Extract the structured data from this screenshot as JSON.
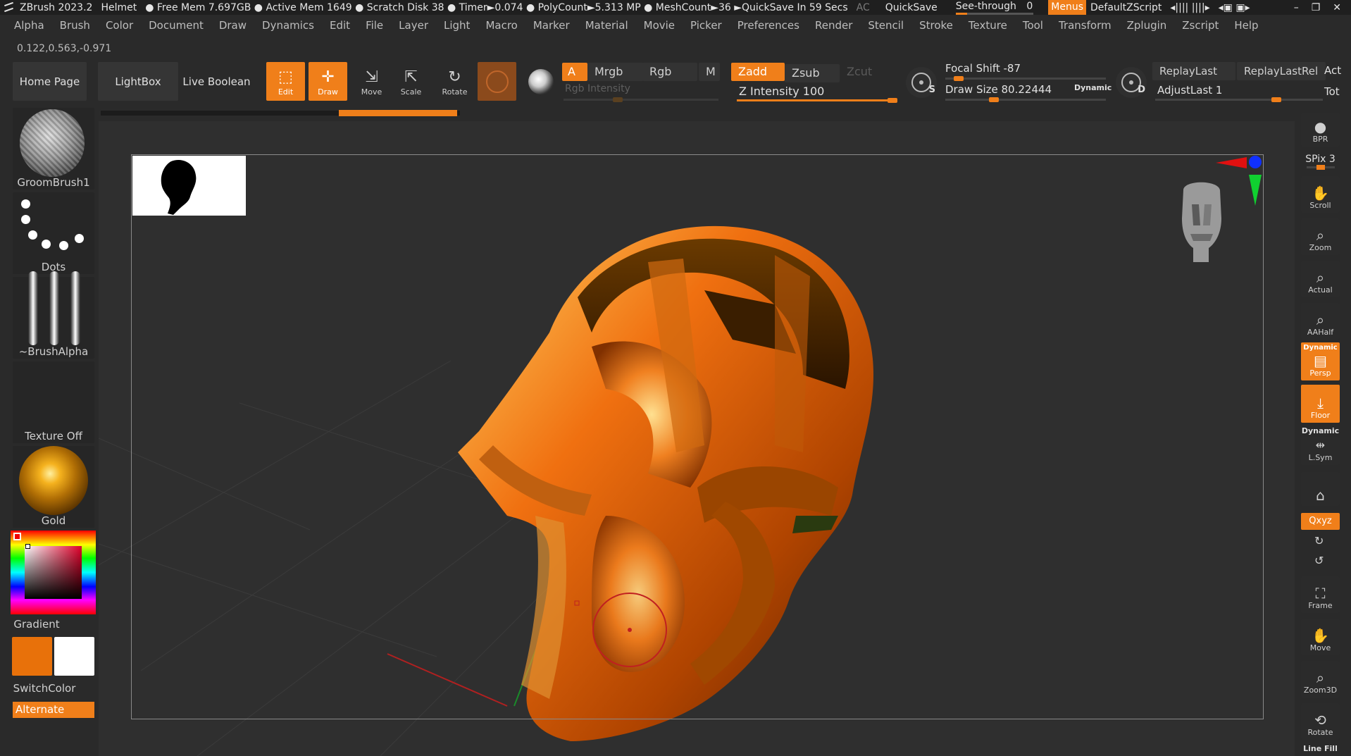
{
  "titlebar": {
    "app": "ZBrush 2023.2",
    "project": "Helmet",
    "stats": "● Free Mem 7.697GB ● Active Mem 1649 ● Scratch Disk 38 ● Timer►0.074 ● PolyCount►5.313 MP ● MeshCount►36 ►QuickSave In 59 Secs",
    "ac": "AC",
    "quicksave": "QuickSave",
    "see_through_label": "See-through",
    "see_through_value": "0",
    "menus": "Menus",
    "default_script": "DefaultZScript"
  },
  "menubar": [
    "Alpha",
    "Brush",
    "Color",
    "Document",
    "Draw",
    "Dynamics",
    "Edit",
    "File",
    "Layer",
    "Light",
    "Macro",
    "Marker",
    "Material",
    "Movie",
    "Picker",
    "Preferences",
    "Render",
    "Stencil",
    "Stroke",
    "Texture",
    "Tool",
    "Transform",
    "Zplugin",
    "Zscript",
    "Help"
  ],
  "coords": "0.122,0.563,-0.971",
  "toolbar": {
    "home_page": "Home Page",
    "lightbox": "LightBox",
    "live_boolean": "Live Boolean",
    "edit": "Edit",
    "draw": "Draw",
    "move": "Move",
    "scale": "Scale",
    "rotate": "Rotate",
    "a": "A",
    "mrgb": "Mrgb",
    "rgb": "Rgb",
    "m": "M",
    "rgb_intensity": "Rgb Intensity",
    "zadd": "Zadd",
    "zsub": "Zsub",
    "zcut": "Zcut",
    "z_intensity": "Z Intensity 100",
    "focal_shift": "Focal Shift -87",
    "draw_size": "Draw Size 80.22444",
    "dynamic": "Dynamic",
    "replay_last": "ReplayLast",
    "replay_last_rel": "ReplayLastRel",
    "adjust_last": "AdjustLast 1",
    "act": "Act",
    "tot": "Tot",
    "s_letter": "S",
    "d_letter": "D"
  },
  "left_shelf": {
    "brush": "GroomBrush1",
    "stroke": "Dots",
    "alpha": "~BrushAlpha",
    "texture": "Texture Off",
    "material": "Gold",
    "gradient": "Gradient",
    "switch_color": "SwitchColor",
    "alternate": "Alternate"
  },
  "colors": {
    "accent": "#f07f1a",
    "main_color": "#e8710a",
    "secondary_color": "#ffffff"
  },
  "right_shelf": {
    "bpr": "BPR",
    "spix": "SPix 3",
    "scroll": "Scroll",
    "zoom": "Zoom",
    "actual": "Actual",
    "aahalf": "AAHalf",
    "dynamic": "Dynamic",
    "persp": "Persp",
    "floor": "Floor",
    "dynamic2": "Dynamic",
    "lsym": "L.Sym",
    "xyz": "Qxyz",
    "frame": "Frame",
    "move": "Move",
    "zoom3d": "Zoom3D",
    "rotate": "Rotate",
    "line_fill": "Line Fill"
  }
}
